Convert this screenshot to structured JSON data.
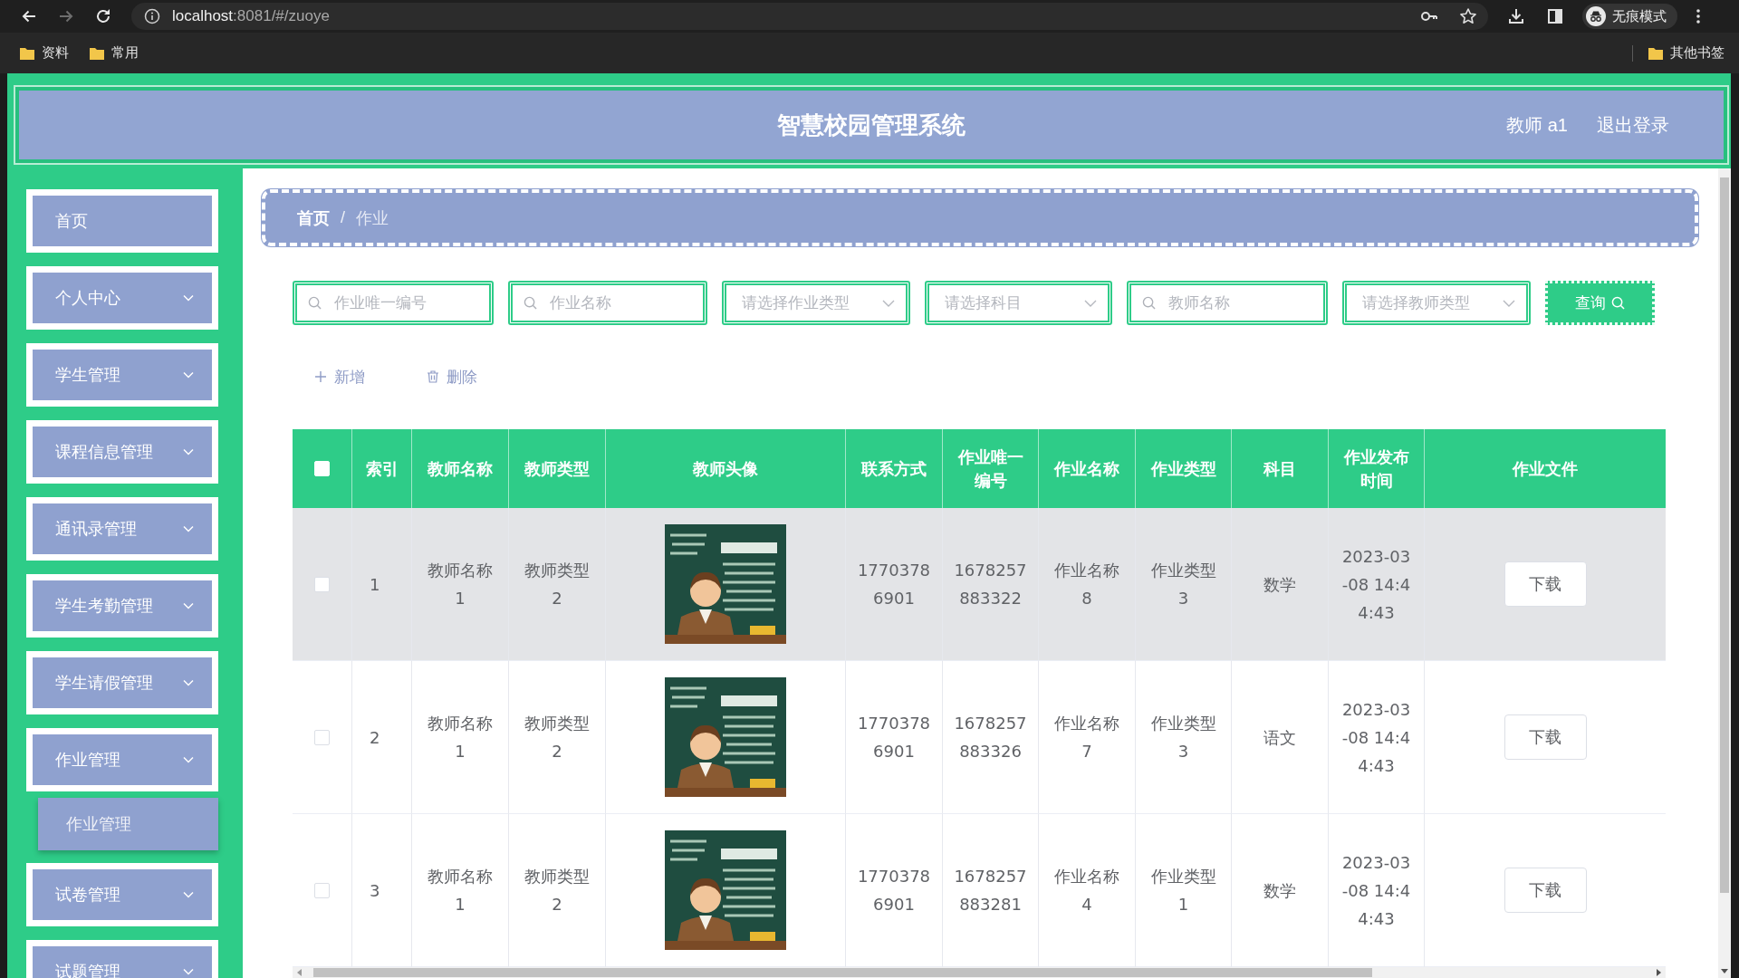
{
  "browser": {
    "forward_disabled": true,
    "address": {
      "host": "localhost",
      "path": ":8081/#/zuoye"
    },
    "profile_label": "无痕模式",
    "bookmarks": [
      {
        "label": "资料"
      },
      {
        "label": "常用"
      }
    ],
    "other_bookmarks": "其他书签"
  },
  "header": {
    "title": "智慧校园管理系统",
    "user": "教师 a1",
    "logout": "退出登录"
  },
  "sidebar": {
    "items": [
      {
        "label": "首页",
        "kind": "link"
      },
      {
        "label": "个人中心",
        "kind": "submenu"
      },
      {
        "label": "学生管理",
        "kind": "submenu"
      },
      {
        "label": "课程信息管理",
        "kind": "submenu"
      },
      {
        "label": "通讯录管理",
        "kind": "submenu"
      },
      {
        "label": "学生考勤管理",
        "kind": "submenu"
      },
      {
        "label": "学生请假管理",
        "kind": "submenu"
      },
      {
        "label": "作业管理",
        "kind": "submenu",
        "children": [
          {
            "label": "作业管理"
          }
        ]
      },
      {
        "label": "试卷管理",
        "kind": "submenu"
      },
      {
        "label": "试题管理",
        "kind": "submenu"
      }
    ]
  },
  "breadcrumb": {
    "items": [
      {
        "label": "首页",
        "current": false
      },
      {
        "label": "作业",
        "current": true
      }
    ],
    "separator": "/"
  },
  "filters": {
    "fields": [
      {
        "kind": "search",
        "placeholder": "作业唯一编号"
      },
      {
        "kind": "search",
        "placeholder": "作业名称"
      },
      {
        "kind": "select",
        "placeholder": "请选择作业类型"
      },
      {
        "kind": "select",
        "placeholder": "请选择科目"
      },
      {
        "kind": "search",
        "placeholder": "教师名称"
      },
      {
        "kind": "select",
        "placeholder": "请选择教师类型"
      }
    ],
    "submit": "查询"
  },
  "actions": [
    {
      "kind": "add",
      "label": "新增"
    },
    {
      "kind": "delete",
      "label": "删除"
    }
  ],
  "table": {
    "all_checked": false,
    "columns": [
      "索引",
      "教师名称",
      "教师类型",
      "教师头像",
      "联系方式",
      "作业唯一编号",
      "作业名称",
      "作业类型",
      "科目",
      "作业发布时间",
      "作业文件"
    ],
    "rows": [
      {
        "checked": false,
        "hovered": true,
        "index": "1",
        "teacher_name": "教师名称1",
        "teacher_type": "教师类型2",
        "phone": "17703786901",
        "homework_no": "1678257883322",
        "homework_name": "作业名称8",
        "homework_type": "作业类型3",
        "subject": "数学",
        "published": "2023-03-08 14:44:43",
        "file_button": "下载"
      },
      {
        "checked": false,
        "hovered": false,
        "index": "2",
        "teacher_name": "教师名称1",
        "teacher_type": "教师类型2",
        "phone": "17703786901",
        "homework_no": "1678257883326",
        "homework_name": "作业名称7",
        "homework_type": "作业类型3",
        "subject": "语文",
        "published": "2023-03-08 14:44:43",
        "file_button": "下载"
      },
      {
        "checked": false,
        "hovered": false,
        "index": "3",
        "teacher_name": "教师名称1",
        "teacher_type": "教师类型2",
        "phone": "17703786901",
        "homework_no": "1678257883281",
        "homework_name": "作业名称4",
        "homework_type": "作业类型1",
        "subject": "数学",
        "published": "2023-03-08 14:44:43",
        "file_button": "下载"
      }
    ]
  }
}
